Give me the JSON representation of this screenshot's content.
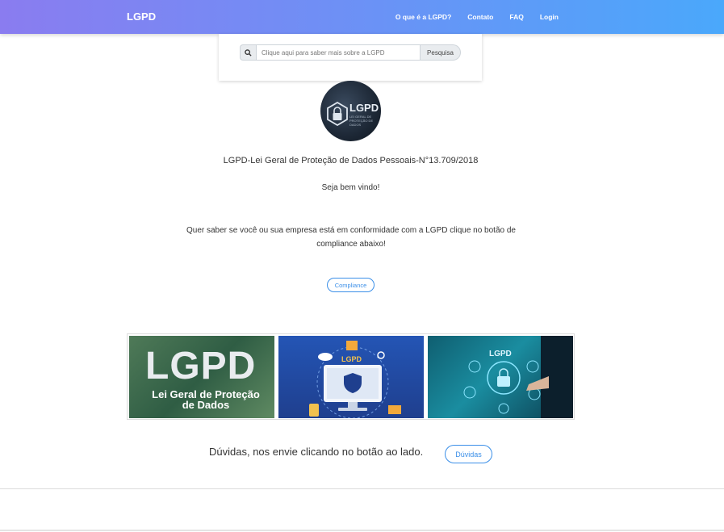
{
  "navbar": {
    "brand": "LGPD",
    "links": [
      "O que é a LGPD?",
      "Contato",
      "FAQ",
      "Login"
    ]
  },
  "search": {
    "placeholder": "Clique aqui para saber mais sobre a LGPD",
    "button_label": "Pesquisa",
    "icon": "search-icon"
  },
  "logo": {
    "text": "LGPD",
    "subtext": "LEI GERAL DE PROTEÇÃO DE DADOS"
  },
  "main": {
    "title": "LGPD-Lei Geral de Proteção de Dados Pessoais-N°13.709/2018",
    "welcome": "Seja bem vindo!",
    "question": "Quer saber se você ou sua empresa está em conformidade com a LGPD clique no botão de compliance abaixo!",
    "compliance_label": "Compliance"
  },
  "gallery": {
    "tile1_big": "LGPD",
    "tile1_sub": "Lei Geral de Proteção de Dados",
    "tile2_label": "LGPD",
    "tile3_label": "LGPD"
  },
  "footer_cta": {
    "text": "Dúvidas, nos envie clicando no botão ao lado.",
    "button_label": "Dúvidas"
  },
  "colors": {
    "nav_gradient_start": "#8a7cf0",
    "nav_gradient_end": "#4aa8fb",
    "button_accent": "#3b8fe8"
  }
}
